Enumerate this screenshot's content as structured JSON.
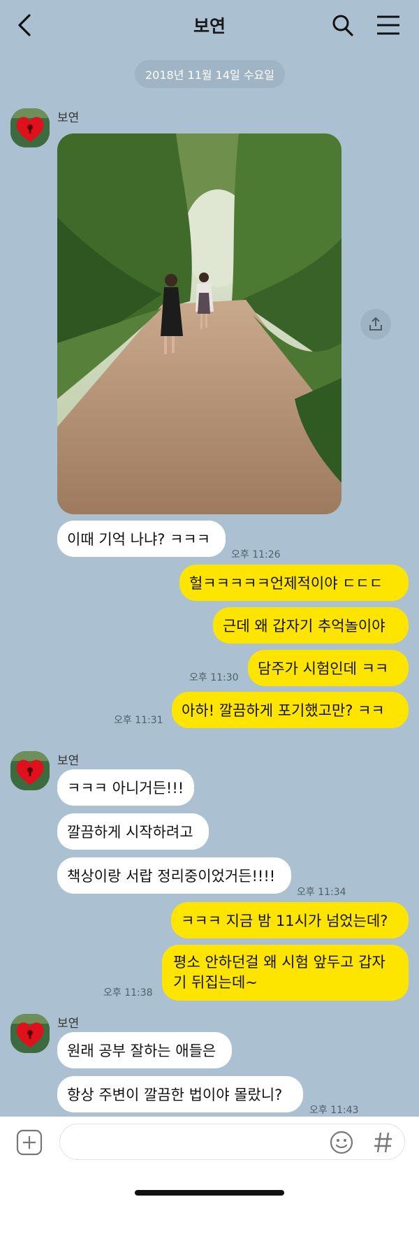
{
  "header": {
    "title": "보연",
    "back_icon": "chevron-left-icon",
    "search_icon": "search-icon",
    "menu_icon": "hamburger-menu-icon"
  },
  "date_divider": "2018년 11월 14일 수요일",
  "groups": [
    {
      "sender": "보연"
    },
    {
      "sender": "보연"
    },
    {
      "sender": "보연"
    }
  ],
  "messages": {
    "m1": "이때 기억 나냐? ㅋㅋㅋ",
    "t1": "오후 11:26",
    "m2": "헐ㅋㅋㅋㅋㅋ언제적이야 ㄷㄷㄷ",
    "m3": "근데 왜 갑자기 추억놀이야",
    "m4": "담주가 시험인데 ㅋㅋ",
    "t4": "오후 11:30",
    "m5": "아하! 깔끔하게 포기했고만? ㅋㅋ",
    "t5": "오후 11:31",
    "m6": "ㅋㅋㅋ 아니거든!!!",
    "m7": "깔끔하게 시작하려고",
    "m8": "책상이랑 서랍 정리중이었거든!!!!",
    "t8": "오후 11:34",
    "m9": "ㅋㅋㅋ 지금 밤 11시가 넘었는데?",
    "m10": "평소 안하던걸 왜 시험 앞두고 갑자기 뒤집는데~",
    "t10": "오후 11:38",
    "m11": "원래 공부 잘하는 애들은",
    "m12": "항상 주변이 깔끔한 법이야 몰랐니?",
    "t12": "오후 11:43"
  },
  "input": {
    "placeholder": "",
    "add_icon": "plus-square-icon",
    "emoji_icon": "emoji-icon",
    "hash_icon": "hashtag-icon"
  },
  "colors": {
    "background": "#abc1d1",
    "outgoing": "#fee500",
    "incoming": "#ffffff"
  }
}
